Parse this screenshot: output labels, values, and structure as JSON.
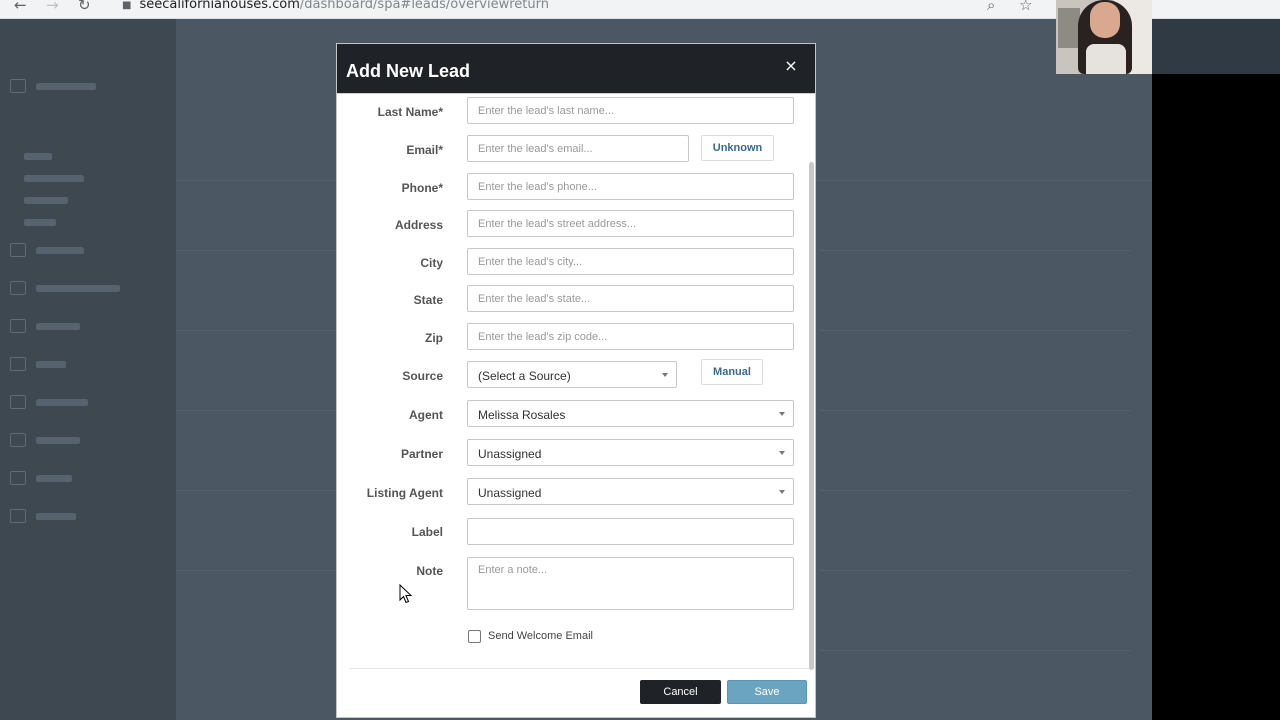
{
  "browser": {
    "url_host": "seecalifornianouses.com",
    "url_path": "/dashboard/spa#leads/overviewreturn"
  },
  "modal": {
    "title": "Add New Lead",
    "close_glyph": "×",
    "fields": {
      "last_name": {
        "label": "Last Name*",
        "placeholder": "Enter the lead's last name..."
      },
      "email": {
        "label": "Email*",
        "placeholder": "Enter the lead's email...",
        "action": "Unknown"
      },
      "phone": {
        "label": "Phone*",
        "placeholder": "Enter the lead's phone..."
      },
      "address": {
        "label": "Address",
        "placeholder": "Enter the lead's street address..."
      },
      "city": {
        "label": "City",
        "placeholder": "Enter the lead's city..."
      },
      "state": {
        "label": "State",
        "placeholder": "Enter the lead's state..."
      },
      "zip": {
        "label": "Zip",
        "placeholder": "Enter the lead's zip code..."
      },
      "source": {
        "label": "Source",
        "value": "(Select a Source)",
        "action": "Manual"
      },
      "agent": {
        "label": "Agent",
        "value": "Melissa Rosales"
      },
      "partner": {
        "label": "Partner",
        "value": "Unassigned"
      },
      "listing_agent": {
        "label": "Listing Agent",
        "value": "Unassigned"
      },
      "label": {
        "label": "Label",
        "value": ""
      },
      "note": {
        "label": "Note",
        "placeholder": "Enter a note..."
      }
    },
    "send_welcome_email": {
      "label": "Send Welcome Email",
      "checked": false
    },
    "buttons": {
      "cancel": "Cancel",
      "save": "Save"
    }
  },
  "colors": {
    "header_bg": "#1f2226",
    "save_bg": "#6aa4c0",
    "link_text": "#3d6a8a",
    "overlay": "#4b5863"
  }
}
